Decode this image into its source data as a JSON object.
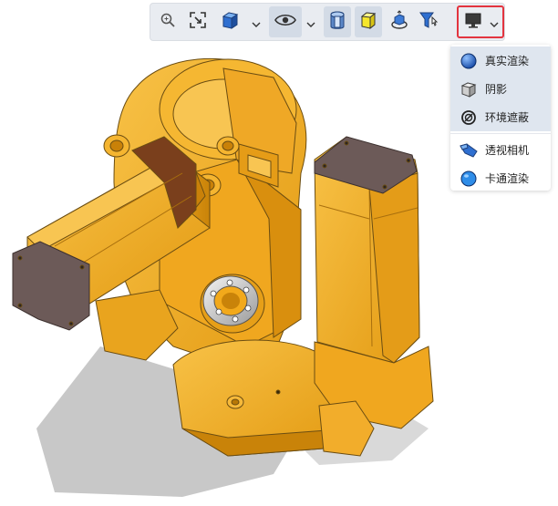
{
  "toolbar": {
    "tools": [
      {
        "name": "zoom-icon"
      },
      {
        "name": "fit-view-icon"
      },
      {
        "name": "view-cube-icon"
      },
      {
        "name": "visibility-eye-icon"
      },
      {
        "name": "section-icon"
      },
      {
        "name": "display-mode-cube-icon"
      },
      {
        "name": "explode-icon"
      },
      {
        "name": "filter-icon"
      },
      {
        "name": "render-mode-monitor-icon"
      }
    ]
  },
  "render_menu": {
    "items": [
      {
        "label": "真实渲染",
        "icon": "realistic-sphere-icon",
        "selected": true
      },
      {
        "label": "阴影",
        "icon": "shadow-cube-icon",
        "selected": true
      },
      {
        "label": "环境遮蔽",
        "icon": "ambient-occlusion-icon",
        "selected": true
      },
      {
        "label": "透视相机",
        "icon": "perspective-camera-icon",
        "selected": false
      },
      {
        "label": "卡通渲染",
        "icon": "cartoon-sphere-icon",
        "selected": false
      }
    ]
  },
  "colors": {
    "part_orange": "#f2a91b",
    "part_shade": "#c97f0a",
    "motor_cap": "#6c5a58",
    "accent_red": "#e3343f",
    "shadow": "#bdbdbd"
  }
}
